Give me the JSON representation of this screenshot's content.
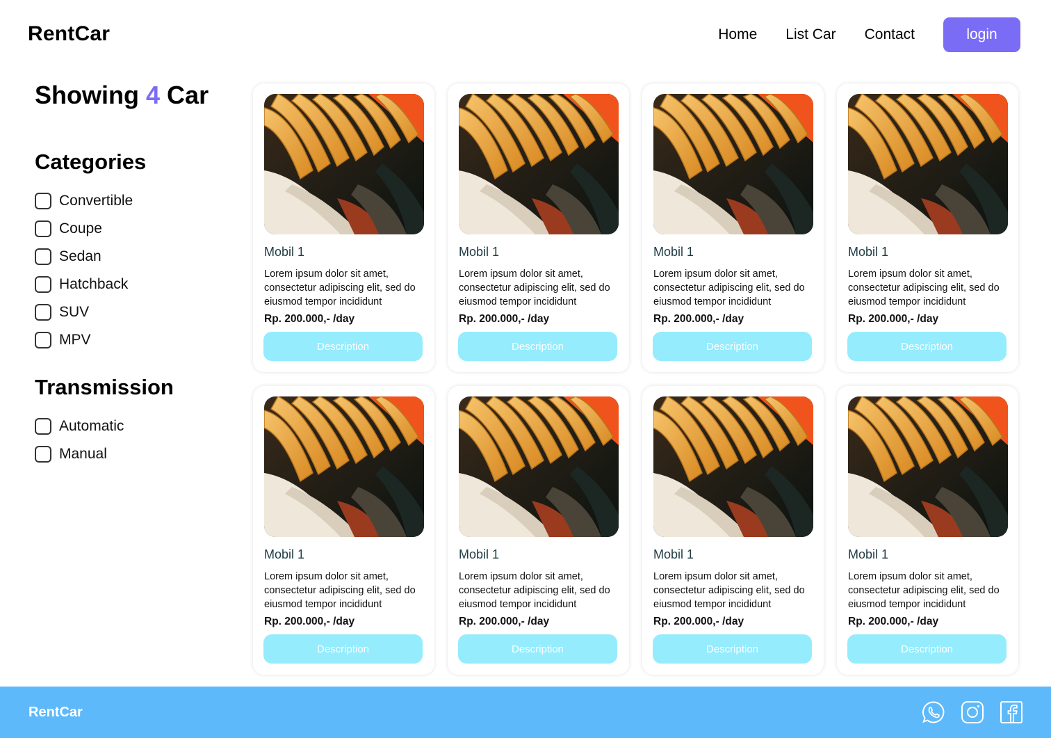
{
  "header": {
    "brand": "RentCar",
    "nav": [
      "Home",
      "List Car",
      "Contact"
    ],
    "login_label": "login"
  },
  "sidebar": {
    "showing_prefix": "Showing",
    "showing_count": "4",
    "showing_suffix": "Car",
    "categories_title": "Categories",
    "categories": [
      "Convertible",
      "Coupe",
      "Sedan",
      "Hatchback",
      "SUV",
      "MPV"
    ],
    "transmission_title": "Transmission",
    "transmission": [
      "Automatic",
      "Manual"
    ]
  },
  "cars": [
    {
      "title": "Mobil 1",
      "desc": "Lorem ipsum dolor sit amet, consectetur adipiscing elit, sed do eiusmod tempor incididunt",
      "price": "Rp. 200.000,- /day",
      "button": "Description"
    },
    {
      "title": "Mobil 1",
      "desc": "Lorem ipsum dolor sit amet, consectetur adipiscing elit, sed do eiusmod tempor incididunt",
      "price": "Rp. 200.000,- /day",
      "button": "Description"
    },
    {
      "title": "Mobil 1",
      "desc": "Lorem ipsum dolor sit amet, consectetur adipiscing elit, sed do eiusmod tempor incididunt",
      "price": "Rp. 200.000,- /day",
      "button": "Description"
    },
    {
      "title": "Mobil 1",
      "desc": "Lorem ipsum dolor sit amet, consectetur adipiscing elit, sed do eiusmod tempor incididunt",
      "price": "Rp. 200.000,- /day",
      "button": "Description"
    },
    {
      "title": "Mobil 1",
      "desc": "Lorem ipsum dolor sit amet, consectetur adipiscing elit, sed do eiusmod tempor incididunt",
      "price": "Rp. 200.000,- /day",
      "button": "Description"
    },
    {
      "title": "Mobil 1",
      "desc": "Lorem ipsum dolor sit amet, consectetur adipiscing elit, sed do eiusmod tempor incididunt",
      "price": "Rp. 200.000,- /day",
      "button": "Description"
    },
    {
      "title": "Mobil 1",
      "desc": "Lorem ipsum dolor sit amet, consectetur adipiscing elit, sed do eiusmod tempor incididunt",
      "price": "Rp. 200.000,- /day",
      "button": "Description"
    },
    {
      "title": "Mobil 1",
      "desc": "Lorem ipsum dolor sit amet, consectetur adipiscing elit, sed do eiusmod tempor incididunt",
      "price": "Rp. 200.000,- /day",
      "button": "Description"
    }
  ],
  "footer": {
    "brand": "RentCar",
    "social_icons": [
      "whatsapp-icon",
      "instagram-icon",
      "facebook-icon"
    ]
  },
  "colors": {
    "accent": "#7B6CF6",
    "button_light_blue": "#94ECFD",
    "footer_blue": "#5EB9FA"
  }
}
